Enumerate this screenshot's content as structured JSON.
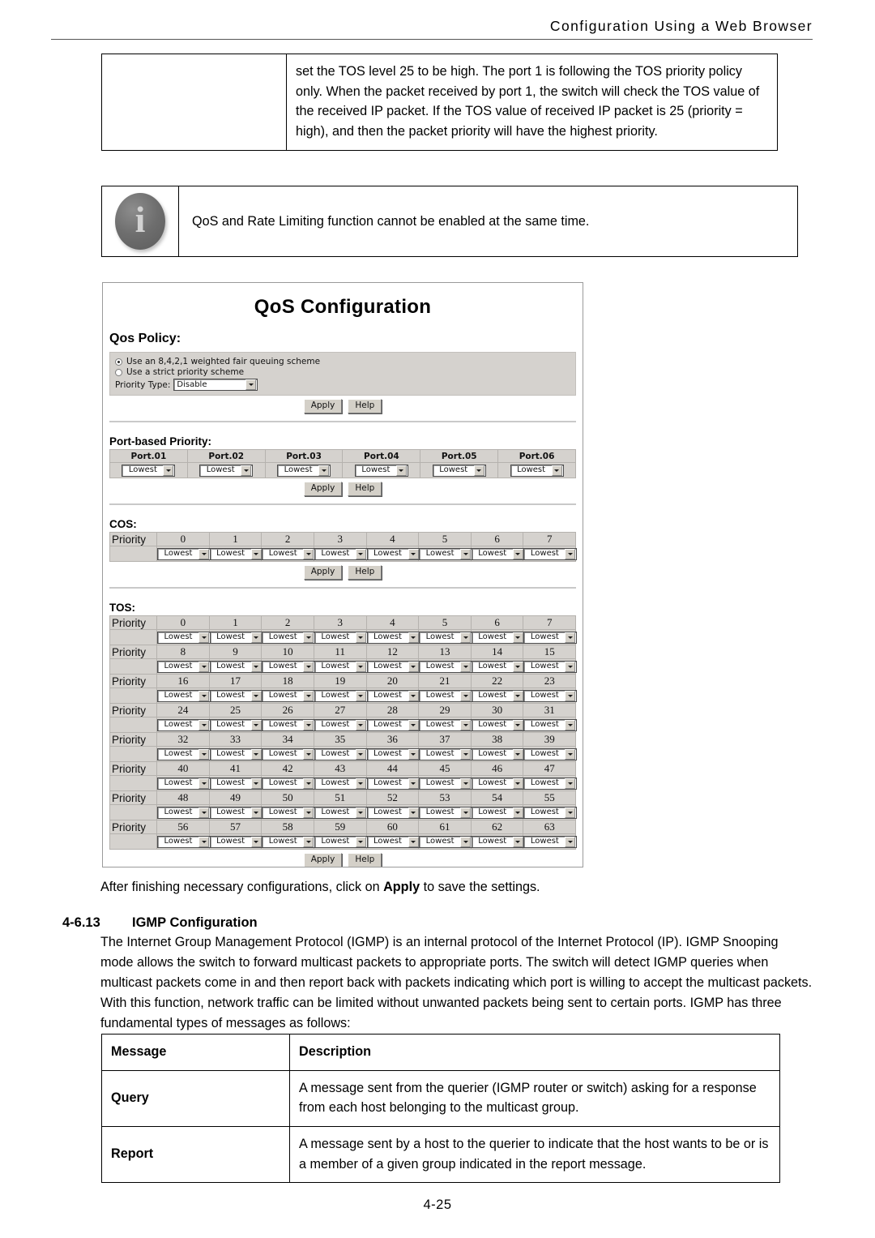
{
  "page": {
    "running_header": "Configuration  Using  a  Web  Browser",
    "page_number": "4-25"
  },
  "tos_note_table": {
    "left_cell": "",
    "text": "set the TOS level 25 to be high. The port 1 is following the TOS priority policy only. When the packet received by port 1, the switch will check the TOS value of the received IP packet. If the TOS value of received IP packet is 25 (priority = high), and then the packet priority will have the highest priority."
  },
  "note_box": {
    "icon": "info-icon",
    "glyph": "i",
    "text": "QoS and Rate Limiting function cannot be enabled at the same time."
  },
  "qos_screenshot": {
    "title": "QoS Configuration",
    "qos_policy": {
      "heading": "Qos Policy:",
      "radio_wfq": "Use an 8,4,2,1 weighted fair queuing scheme",
      "radio_strict": "Use a strict priority scheme",
      "radio_selected": "wfq",
      "priority_type_label": "Priority Type:",
      "priority_type_value": "Disable",
      "apply_label": "Apply",
      "help_label": "Help"
    },
    "port_based": {
      "heading": "Port-based Priority:",
      "ports": [
        "Port.01",
        "Port.02",
        "Port.03",
        "Port.04",
        "Port.05",
        "Port.06"
      ],
      "values": [
        "Lowest",
        "Lowest",
        "Lowest",
        "Lowest",
        "Lowest",
        "Lowest"
      ],
      "apply_label": "Apply",
      "help_label": "Help"
    },
    "cos": {
      "heading": "COS:",
      "priority_label": "Priority",
      "levels": [
        "0",
        "1",
        "2",
        "3",
        "4",
        "5",
        "6",
        "7"
      ],
      "values": [
        "Lowest",
        "Lowest",
        "Lowest",
        "Lowest",
        "Lowest",
        "Lowest",
        "Lowest",
        "Lowest"
      ],
      "apply_label": "Apply",
      "help_label": "Help"
    },
    "tos": {
      "heading": "TOS:",
      "priority_label": "Priority",
      "rows": [
        [
          "0",
          "1",
          "2",
          "3",
          "4",
          "5",
          "6",
          "7"
        ],
        [
          "8",
          "9",
          "10",
          "11",
          "12",
          "13",
          "14",
          "15"
        ],
        [
          "16",
          "17",
          "18",
          "19",
          "20",
          "21",
          "22",
          "23"
        ],
        [
          "24",
          "25",
          "26",
          "27",
          "28",
          "29",
          "30",
          "31"
        ],
        [
          "32",
          "33",
          "34",
          "35",
          "36",
          "37",
          "38",
          "39"
        ],
        [
          "40",
          "41",
          "42",
          "43",
          "44",
          "45",
          "46",
          "47"
        ],
        [
          "48",
          "49",
          "50",
          "51",
          "52",
          "53",
          "54",
          "55"
        ],
        [
          "56",
          "57",
          "58",
          "59",
          "60",
          "61",
          "62",
          "63"
        ]
      ],
      "value": "Lowest",
      "apply_label": "Apply",
      "help_label": "Help"
    }
  },
  "after_apply_text": "After finishing necessary configurations, click on Apply to save the settings.",
  "after_apply_prefix": "After finishing necessary configurations, click on ",
  "after_apply_bold": "Apply",
  "after_apply_suffix": " to save the settings.",
  "igmp": {
    "section_number": "4-6.13",
    "section_title": "IGMP Configuration",
    "paragraph": "The Internet Group Management Protocol (IGMP) is an internal protocol of the Internet Protocol (IP). IGMP Snooping mode allows the switch to forward multicast packets to appropriate ports. The switch will detect IGMP queries when multicast packets come in and then report back with packets indicating which port is willing to accept the multicast packets. With this function, network traffic can be limited without unwanted packets being sent to certain ports. IGMP has three fundamental types of messages as follows:"
  },
  "message_table": {
    "headers": [
      "Message",
      "Description"
    ],
    "rows": [
      {
        "message": "Query",
        "description": "A message sent from the querier (IGMP router or switch) asking for a response from each host belonging to the multicast group."
      },
      {
        "message": "Report",
        "description": "A message sent by a host to the querier to indicate that the host wants to be or is a member of a given group indicated in the report message."
      }
    ]
  }
}
